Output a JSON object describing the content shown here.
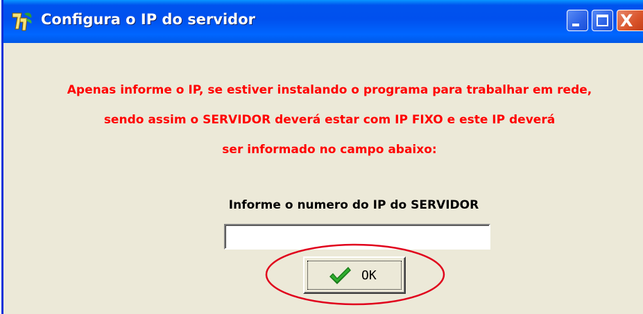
{
  "window": {
    "title": "Configura o IP do servidor",
    "app_icon": "app-logo-icon",
    "controls": {
      "minimize": "minimize-icon",
      "maximize": "maximize-icon",
      "close": "close-icon",
      "close_glyph": "X"
    }
  },
  "message": {
    "line1": "Apenas informe o IP, se estiver instalando o programa para trabalhar em rede,",
    "line2": "sendo assim o SERVIDOR deverá estar com IP FIXO e este IP deverá",
    "line3": "ser informado no campo abaixo:",
    "color": "#ff0000"
  },
  "ip_field": {
    "label": "Informe o numero do IP do SERVIDOR",
    "value": "",
    "placeholder": ""
  },
  "ok_button": {
    "label": "OK",
    "icon": "checkmark-icon"
  },
  "annotation": {
    "shape": "ellipse",
    "color": "#e0001b"
  }
}
